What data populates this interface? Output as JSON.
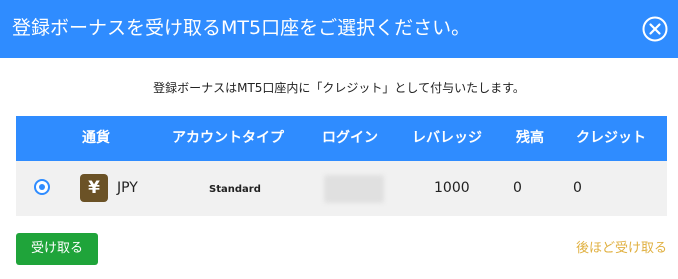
{
  "header": {
    "title": "登録ボーナスを受け取るMT5口座をご選択ください。"
  },
  "subtitle": "登録ボーナスはMT5口座内に「クレジット」として付与いたします。",
  "table": {
    "columns": [
      "通貨",
      "アカウントタイプ",
      "ログイン",
      "レバレッジ",
      "残高",
      "クレジット"
    ],
    "rows": [
      {
        "selected": true,
        "currency_icon": "yen-icon",
        "currency_symbol": "¥",
        "currency": "JPY",
        "account_type": "Standard",
        "login": "",
        "leverage": "1000",
        "balance": "0",
        "credit": "0"
      }
    ]
  },
  "actions": {
    "accept": "受け取る",
    "later": "後ほど受け取る"
  },
  "colors": {
    "primary": "#2f8cff",
    "accept": "#1fa43a",
    "link": "#e0b040",
    "yen_bg": "#6b5226"
  }
}
